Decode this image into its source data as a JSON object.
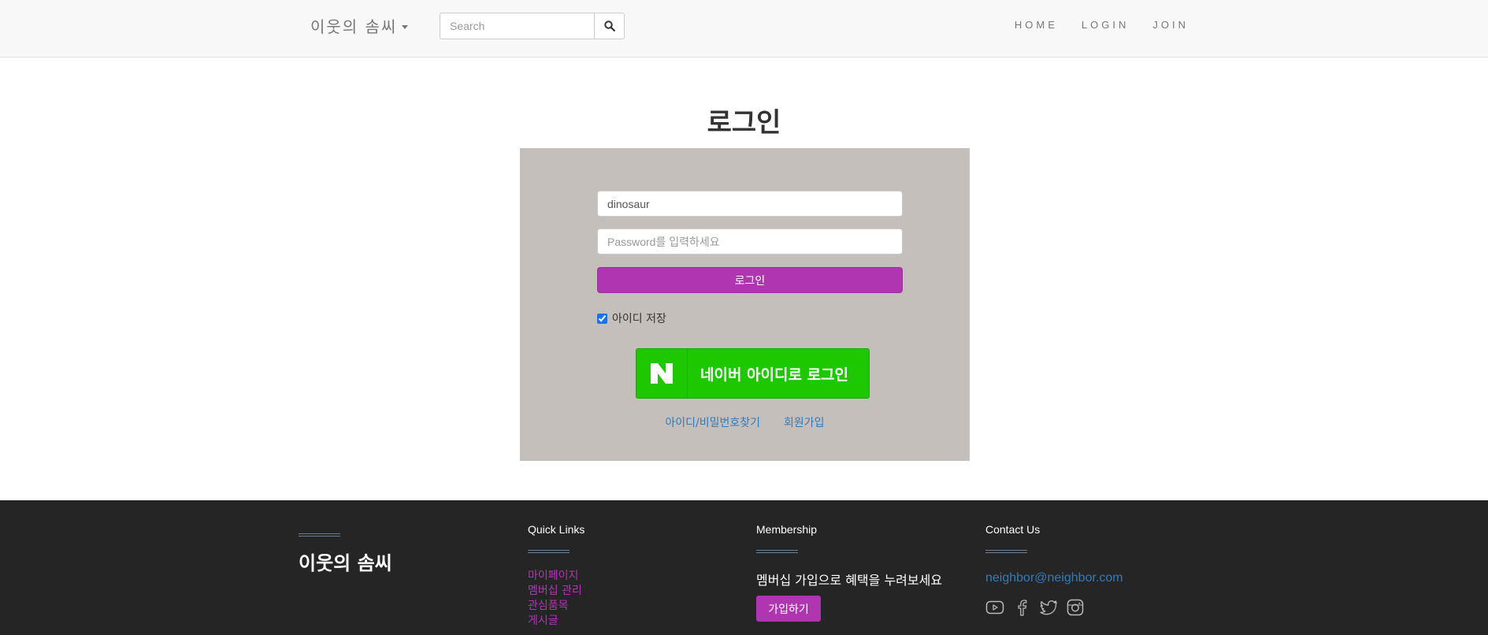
{
  "navbar": {
    "brand": "이웃의 솜씨",
    "search_placeholder": "Search",
    "links": [
      "HOME",
      "LOGIN",
      "JOIN"
    ]
  },
  "login": {
    "title": "로그인",
    "id_value": "dinosaur",
    "password_placeholder": "Password를 입력하세요",
    "login_button": "로그인",
    "remember_label": "아이디 저장",
    "remember_checked": true,
    "naver_button": "네이버 아이디로 로그인",
    "find_account_link": "아이디/비밀번호찾기",
    "signup_link": "회원가입"
  },
  "footer": {
    "brand": "이웃의 솜씨",
    "quick_links_title": "Quick Links",
    "quick_links": [
      "마이페이지",
      "멤버십 관리",
      "관심품목",
      "게시글"
    ],
    "membership_title": "Membership",
    "membership_text": "멤버십 가입으로 혜택을 누려보세요",
    "membership_button": "가입하기",
    "contact_title": "Contact Us",
    "email": "neighbor@neighbor.com",
    "social_icons": [
      "youtube-icon",
      "facebook-icon",
      "twitter-icon",
      "instagram-icon"
    ]
  },
  "colors": {
    "accent": "#b036b1",
    "naver_green": "#1ec800",
    "login_box_bg": "#c5bfbc",
    "footer_bg": "#252525",
    "link_blue": "#337ab7"
  }
}
